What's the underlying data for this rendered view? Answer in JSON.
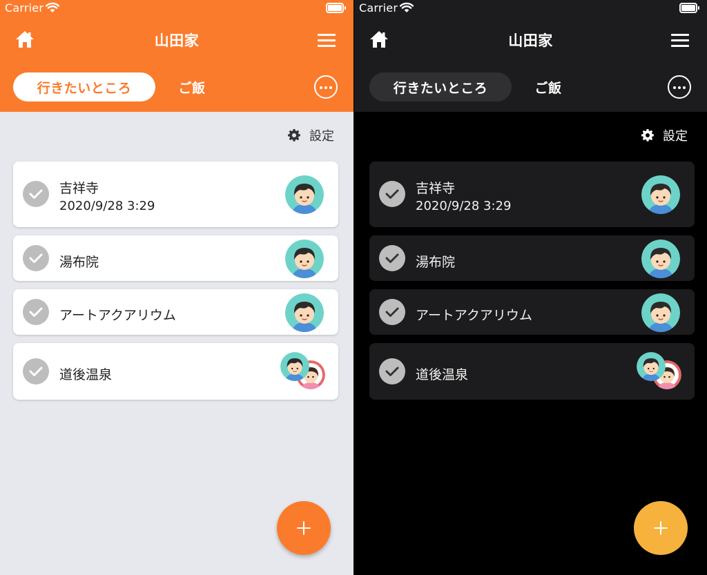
{
  "status_bar": {
    "carrier": "Carrier"
  },
  "header": {
    "title": "山田家"
  },
  "tabs": [
    {
      "label": "行きたいところ",
      "active": true
    },
    {
      "label": "ご飯",
      "active": false
    }
  ],
  "settings": {
    "label": "設定"
  },
  "items": [
    {
      "title": "吉祥寺",
      "subtitle": "2020/9/28 3:29",
      "avatars": [
        "boy"
      ]
    },
    {
      "title": "湯布院",
      "avatars": [
        "boy"
      ]
    },
    {
      "title": "アートアクアリウム",
      "avatars": [
        "boy"
      ]
    },
    {
      "title": "道後温泉",
      "avatars": [
        "boy",
        "girl"
      ]
    }
  ],
  "icons": {
    "home": "home-icon",
    "menu": "menu-icon",
    "more": "more-icon",
    "settings": "gear-icon",
    "check": "check-icon",
    "add": "plus-icon"
  },
  "themes": {
    "light": {
      "accent": "#fb7b2c",
      "background": "#e6e8ee",
      "card": "#ffffff",
      "fab": "#fb7b2c"
    },
    "dark": {
      "accent": "#1c1c1e",
      "background": "#000000",
      "card": "#1c1c1e",
      "fab": "#f6b23d"
    }
  }
}
